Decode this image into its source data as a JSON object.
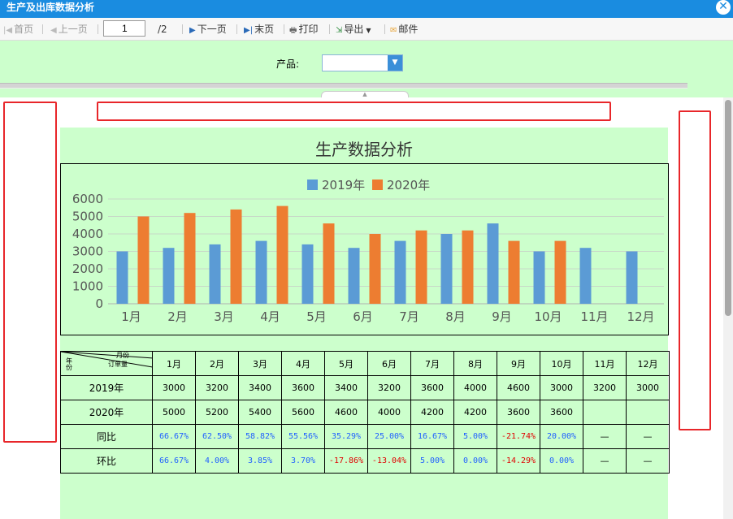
{
  "window": {
    "title": "生产及出库数据分析"
  },
  "toolbar": {
    "first": "首页",
    "prev": "上一页",
    "page": "1",
    "total": "/2",
    "next": "下一页",
    "last": "末页",
    "print": "打印",
    "export": "导出",
    "mail": "邮件"
  },
  "filter": {
    "label": "产品:",
    "value": ""
  },
  "report": {
    "header_corner": {
      "top": "月份",
      "mid": "订单量",
      "left": "年份"
    },
    "rows": [
      {
        "label": "2019年",
        "cells": [
          "3000",
          "3200",
          "3400",
          "3600",
          "3400",
          "3200",
          "3600",
          "4000",
          "4600",
          "3000",
          "3200",
          "3000"
        ]
      },
      {
        "label": "2020年",
        "cells": [
          "5000",
          "5200",
          "5400",
          "5600",
          "4600",
          "4000",
          "4200",
          "4200",
          "3600",
          "3600",
          "",
          ""
        ]
      },
      {
        "label": "同比",
        "cells": [
          "66.67%",
          "62.50%",
          "58.82%",
          "55.56%",
          "35.29%",
          "25.00%",
          "16.67%",
          "5.00%",
          "-21.74%",
          "20.00%",
          "—",
          "—"
        ]
      },
      {
        "label": "环比",
        "cells": [
          "66.67%",
          "4.00%",
          "3.85%",
          "3.70%",
          "-17.86%",
          "-13.04%",
          "5.00%",
          "0.00%",
          "-14.29%",
          "0.00%",
          "—",
          "—"
        ]
      }
    ]
  },
  "chart_data": {
    "type": "bar",
    "title": "生产数据分析",
    "categories": [
      "1月",
      "2月",
      "3月",
      "4月",
      "5月",
      "6月",
      "7月",
      "8月",
      "9月",
      "10月",
      "11月",
      "12月"
    ],
    "series": [
      {
        "name": "2019年",
        "color": "#5b9bd5",
        "values": [
          3000,
          3200,
          3400,
          3600,
          3400,
          3200,
          3600,
          4000,
          4600,
          3000,
          3200,
          3000
        ]
      },
      {
        "name": "2020年",
        "color": "#ed7d31",
        "values": [
          5000,
          5200,
          5400,
          5600,
          4600,
          4000,
          4200,
          4200,
          3600,
          3600,
          null,
          null
        ]
      }
    ],
    "yticks": [
      "0",
      "1000",
      "2000",
      "3000",
      "4000",
      "5000",
      "6000"
    ],
    "ylim": [
      0,
      6000
    ],
    "legend": "top",
    "grid": true
  }
}
